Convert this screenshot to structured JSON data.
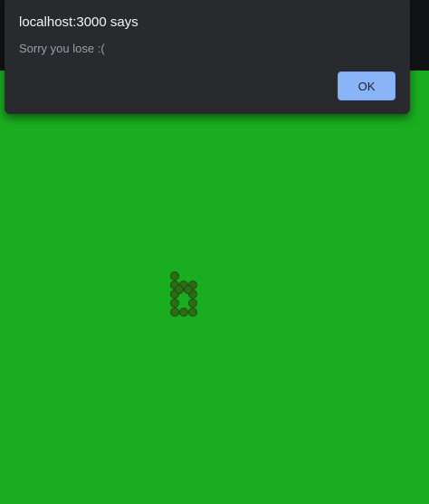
{
  "page": {
    "background": "#111214",
    "game_background": "#1aad1f"
  },
  "dialog": {
    "title": "localhost:3000 says",
    "message": "Sorry you lose :(",
    "ok_label": "OK"
  },
  "game": {
    "snake_segment_count": 13,
    "snake_color": "#2e6b16"
  }
}
